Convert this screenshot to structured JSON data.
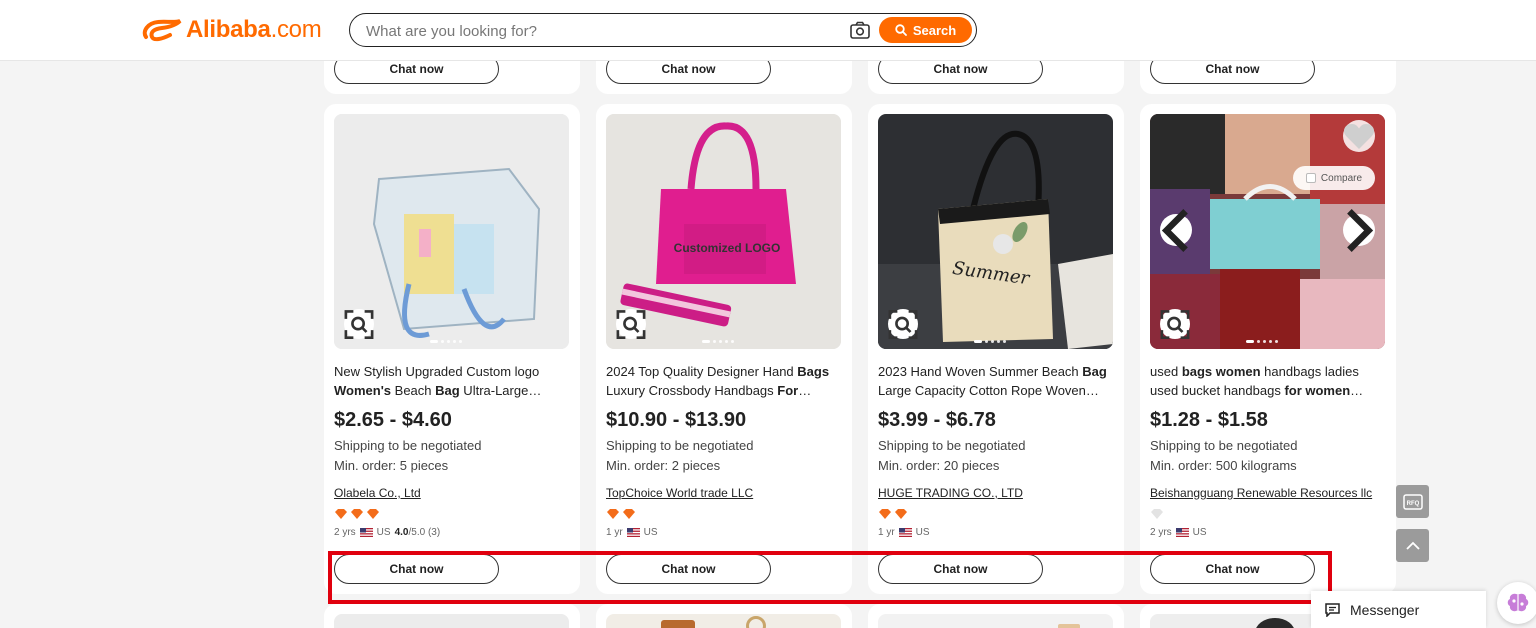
{
  "header": {
    "logo_main": "Alibaba",
    "logo_suffix": ".com",
    "search_placeholder": "What are you looking for?",
    "search_button": "Search"
  },
  "chat_label": "Chat now",
  "products": [
    {
      "title_html": "New Stylish Upgraded Custom logo <b>Women's</b> Beach <b>Bag</b> Ultra-Large…",
      "price": "$2.65 - $4.60",
      "shipping": "Shipping to be negotiated",
      "min_order": "Min. order: 5 pieces",
      "supplier": "Olabela Co., Ltd",
      "diamonds": 3,
      "years": "2 yrs",
      "country": "US",
      "rating": "4.0",
      "rating_suffix": "/5.0 (3)"
    },
    {
      "title_html": "2024 Top Quality Designer Hand <b>Bags</b> Luxury Crossbody Handbags <b>For</b>…",
      "image_text": "Customized LOGO",
      "price": "$10.90 - $13.90",
      "shipping": "Shipping to be negotiated",
      "min_order": "Min. order: 2 pieces",
      "supplier": "TopChoice World trade LLC",
      "diamonds": 2,
      "years": "1 yr",
      "country": "US"
    },
    {
      "title_html": "2023 Hand Woven Summer Beach <b>Bag</b> Large Capacity Cotton Rope Woven…",
      "image_text": "Summer",
      "price": "$3.99 - $6.78",
      "shipping": "Shipping to be negotiated",
      "min_order": "Min. order: 20 pieces",
      "supplier": "HUGE TRADING CO., LTD",
      "diamonds": 2,
      "years": "1 yr",
      "country": "US"
    },
    {
      "title_html": "used <b>bags women</b> handbags ladies used bucket handbags <b>for women</b>…",
      "price": "$1.28 - $1.58",
      "shipping": "Shipping to be negotiated",
      "min_order": "Min. order: 500 kilograms",
      "supplier": "Beishangguang Renewable Resources llc",
      "diamonds": 0,
      "years": "2 yrs",
      "country": "US",
      "compare_label": "Compare"
    }
  ],
  "side": {
    "rfq_label": "RFQ",
    "messenger_label": "Messenger"
  },
  "colors": {
    "brand": "#ff6a00",
    "highlight": "#e0000e"
  }
}
